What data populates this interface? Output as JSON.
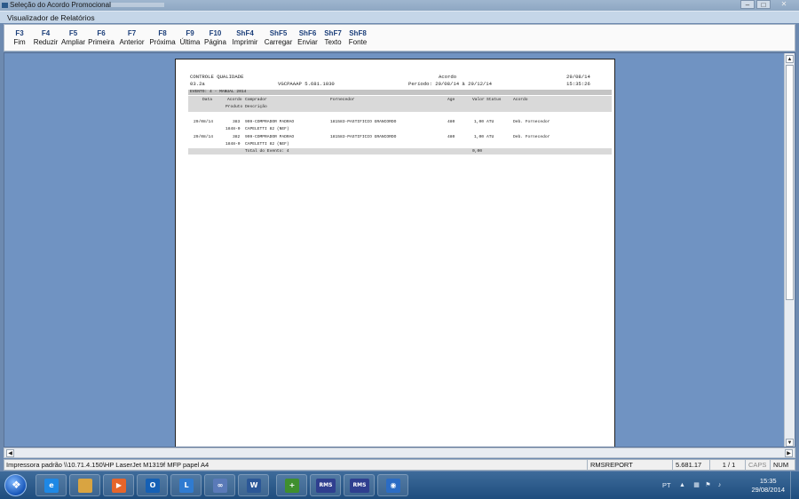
{
  "outer_window": {
    "title": "Seleção do Acordo Promocional"
  },
  "inner_window": {
    "title": "Visualizador de Relatórios"
  },
  "toolbar": {
    "items": [
      {
        "key": "F3",
        "label": "Fim"
      },
      {
        "key": "F4",
        "label": "Reduzir"
      },
      {
        "key": "F5",
        "label": "Ampliar"
      },
      {
        "key": "F6",
        "label": "Primeira"
      },
      {
        "key": "F7",
        "label": "Anterior"
      },
      {
        "key": "F8",
        "label": "Próxima"
      },
      {
        "key": "F9",
        "label": "Última"
      },
      {
        "key": "F10",
        "label": "Página"
      },
      {
        "key": "ShF4",
        "label": "Imprimir"
      },
      {
        "key": "ShF5",
        "label": "Carregar"
      },
      {
        "key": "ShF6",
        "label": "Enviar"
      },
      {
        "key": "ShF7",
        "label": "Texto"
      },
      {
        "key": "ShF8",
        "label": "Fonte"
      }
    ]
  },
  "report": {
    "title": "CONTROLE QUALIDADE",
    "code": "03.2a",
    "program": "VGCPAAAP 5.681.1030",
    "name": "Acordo",
    "period": "Período: 29/08/14 à 29/12/14",
    "date": "29/08/14",
    "time": "15:35:26",
    "section": "EVENTO: 4 - MANUAL 2014",
    "columns": {
      "data": "Data",
      "acordo": "Acordo",
      "comprador": "Comprador",
      "fornecedor": "Fornecedor",
      "age": "Age",
      "valor": "Valor",
      "status": "Status",
      "acordo2": "Acordo",
      "produto": "Produto",
      "descricao": "Descrição"
    },
    "rows": [
      {
        "data": "29/08/14",
        "acordo": "383",
        "comprador": "999-COMPRADOR PADRAO",
        "fornecedor": "181583-PASTIFICIO GRANCORDO",
        "age": "480",
        "valor": "1,00",
        "status": "ATU",
        "tipo": "Deb. Fornecedor",
        "produto": "1848-0",
        "descricao": "CAPELETTI 82 (NEF)"
      },
      {
        "data": "29/08/14",
        "acordo": "382",
        "comprador": "999-COMPRADOR PADRAO",
        "fornecedor": "181583-PASTIFICIO GRANCORDO",
        "age": "480",
        "valor": "1,00",
        "status": "ATU",
        "tipo": "Deb. Fornecedor",
        "produto": "1848-0",
        "descricao": "CAPELETTI 82 (NEF)"
      }
    ],
    "total_label": "Total do Evento: 4",
    "total_value": "0,00"
  },
  "statusbar": {
    "printer": "Impressora padrão \\\\10.71.4.150\\HP LaserJet M1319f MFP papel A4",
    "report": "RMSREPORT",
    "version": "5.681.17",
    "page": "1 / 1",
    "caps": "CAPS",
    "num": "NUM"
  },
  "taskbar": {
    "apps": [
      {
        "icon": "internet-explorer-icon",
        "text": "e"
      },
      {
        "icon": "file-explorer-icon",
        "text": ""
      },
      {
        "icon": "media-player-icon",
        "text": "▶"
      },
      {
        "icon": "outlook-icon",
        "text": "O"
      },
      {
        "icon": "lync-icon",
        "text": "L"
      },
      {
        "icon": "link-icon",
        "text": "∞"
      },
      {
        "icon": "word-icon",
        "text": "W"
      },
      {
        "icon": "add-app-icon",
        "text": "+"
      },
      {
        "icon": "rms-icon-1",
        "text": "RMS"
      },
      {
        "icon": "rms-icon-2",
        "text": "RMS"
      },
      {
        "icon": "app-globe-icon",
        "text": "◉"
      }
    ],
    "language": "PT",
    "clock_time": "15:35",
    "clock_date": "29/08/2014"
  }
}
